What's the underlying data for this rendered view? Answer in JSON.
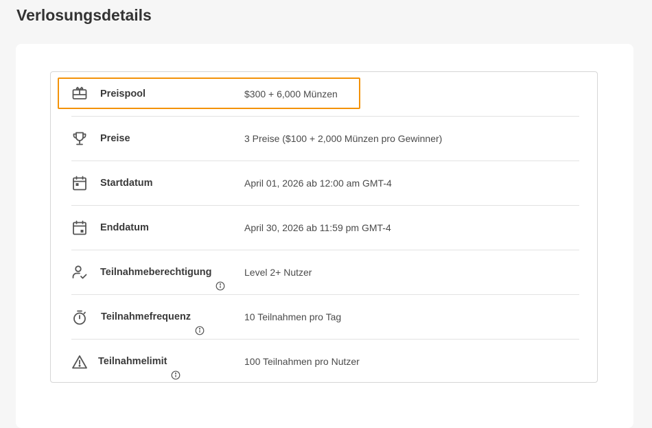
{
  "page": {
    "title": "Verlosungsdetails"
  },
  "details": [
    {
      "icon": "gift-card-icon",
      "label": "Preispool",
      "value": "$300 + 6,000 Münzen",
      "info": false,
      "highlighted": true
    },
    {
      "icon": "trophy-icon",
      "label": "Preise",
      "value": "3 Preise ($100 + 2,000 Münzen pro Gewinner)",
      "info": false,
      "highlighted": false
    },
    {
      "icon": "calendar-start-icon",
      "label": "Startdatum",
      "value": "April 01, 2026 ab 12:00 am GMT-4",
      "info": false,
      "highlighted": false
    },
    {
      "icon": "calendar-end-icon",
      "label": "Enddatum",
      "value": "April 30, 2026 ab 11:59 pm GMT-4",
      "info": false,
      "highlighted": false
    },
    {
      "icon": "user-check-icon",
      "label": "Teilnahmeberechtigung",
      "value": "Level 2+ Nutzer",
      "info": true,
      "highlighted": false
    },
    {
      "icon": "stopwatch-icon",
      "label": "Teilnahmefrequenz",
      "value": "10 Teilnahmen pro Tag",
      "info": true,
      "highlighted": false
    },
    {
      "icon": "warning-icon",
      "label": "Teilnahmelimit",
      "value": "100 Teilnahmen pro Nutzer",
      "info": true,
      "highlighted": false
    }
  ],
  "colors": {
    "highlight": "#f39208",
    "icon": "#555555",
    "label": "#3a3a3a",
    "value": "#4a4a4a"
  }
}
